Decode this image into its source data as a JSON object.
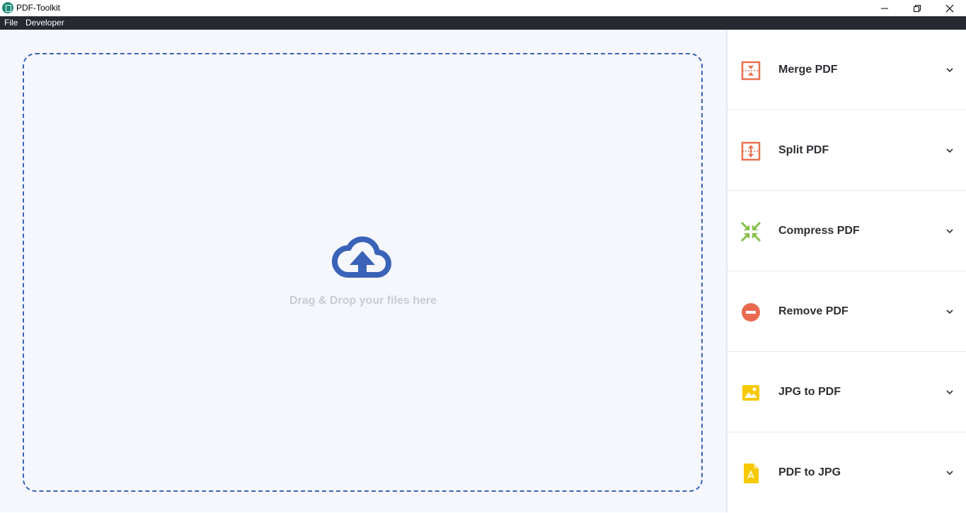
{
  "window": {
    "title": "PDF-Toolkit"
  },
  "menu": {
    "items": [
      "File",
      "Developer"
    ]
  },
  "dropzone": {
    "text": "Drag & Drop your files here"
  },
  "tools": [
    {
      "label": "Merge PDF",
      "icon": "merge-icon",
      "color": "#e8714e"
    },
    {
      "label": "Split PDF",
      "icon": "split-icon",
      "color": "#e8714e"
    },
    {
      "label": "Compress PDF",
      "icon": "compress-icon",
      "color": "#86c049"
    },
    {
      "label": "Remove PDF",
      "icon": "remove-icon",
      "color": "#ea6a4f"
    },
    {
      "label": "JPG to PDF",
      "icon": "image-icon",
      "color": "#f6c900"
    },
    {
      "label": "PDF to JPG",
      "icon": "pdf-file-icon",
      "color": "#f6c900"
    }
  ],
  "colors": {
    "accent": "#3a63b8",
    "menubar": "#26292f",
    "background": "#f5f7fd"
  }
}
